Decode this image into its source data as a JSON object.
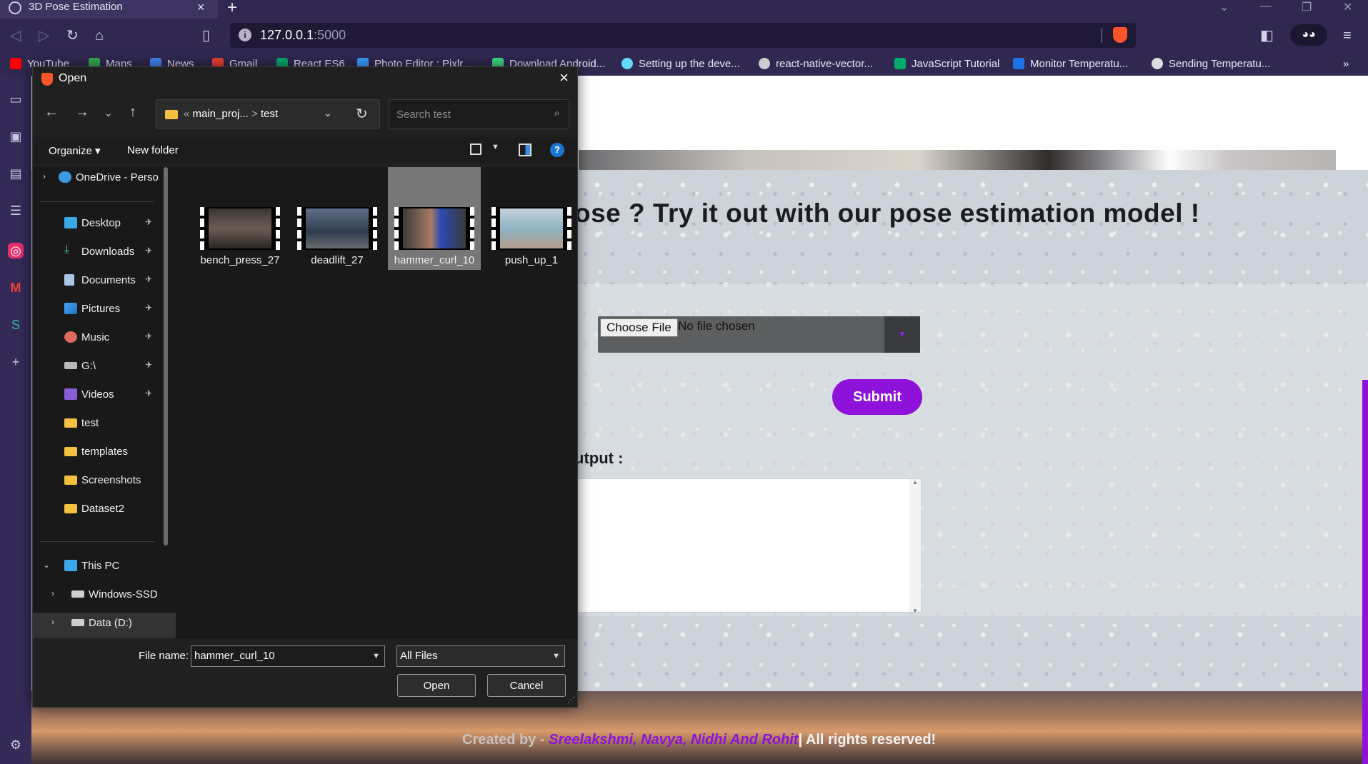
{
  "browser": {
    "tab_title": "3D Pose Estimation",
    "new_tab": "+",
    "url_host": "127.0.0.1",
    "url_port": ":5000",
    "bookmarks": [
      {
        "label": "YouTube",
        "color": "#ff0000"
      },
      {
        "label": "Maps",
        "color": "#34a853"
      },
      {
        "label": "News",
        "color": "#4285f4"
      },
      {
        "label": "Gmail",
        "color": "#ea4335"
      },
      {
        "label": "React ES6",
        "color": "#04aa6d"
      },
      {
        "label": "Photo Editor : Pixlr...",
        "color": "#3aa0ff"
      },
      {
        "label": "Download Android...",
        "color": "#3ddc84"
      },
      {
        "label": "Setting up the deve...",
        "color": "#61dafb"
      },
      {
        "label": "react-native-vector...",
        "color": "#cccccc"
      },
      {
        "label": "JavaScript Tutorial",
        "color": "#04aa6d"
      },
      {
        "label": "Monitor Temperatu...",
        "color": "#1a73e8"
      },
      {
        "label": "Sending Temperatu...",
        "color": "#dddddd"
      }
    ],
    "more_bookmarks": "»"
  },
  "page": {
    "heading": "ose ? Try it out with our pose estimation model !",
    "choose_file": "Choose File",
    "no_file": "No file chosen",
    "submit": "Submit",
    "output_label": "utput :",
    "footer_created": "Created by - ",
    "footer_names": "Sreelakshmi, Navya, Nidhi And Rohit",
    "footer_rights": "| All rights reserved!",
    "accent_color": "#8e12d9"
  },
  "dialog": {
    "title": "Open",
    "breadcrumb_prefix": "«",
    "breadcrumb_1": "main_proj...",
    "breadcrumb_sep": ">",
    "breadcrumb_2": "test",
    "search_placeholder": "Search test",
    "organize": "Organize ▾",
    "new_folder": "New folder",
    "nav_items": [
      {
        "label": "OneDrive - Perso",
        "icon": "cloud-icon"
      },
      {
        "label": "Desktop",
        "icon": "desktop-icon"
      },
      {
        "label": "Downloads",
        "icon": "download-icon"
      },
      {
        "label": "Documents",
        "icon": "document-icon"
      },
      {
        "label": "Pictures",
        "icon": "pictures-icon"
      },
      {
        "label": "Music",
        "icon": "music-icon"
      },
      {
        "label": "G:\\",
        "icon": "drive-icon"
      },
      {
        "label": "Videos",
        "icon": "videos-icon"
      },
      {
        "label": "test",
        "icon": "folder-icon"
      },
      {
        "label": "templates",
        "icon": "folder-icon"
      },
      {
        "label": "Screenshots",
        "icon": "folder-icon"
      },
      {
        "label": "Dataset2",
        "icon": "folder-icon"
      },
      {
        "label": "This PC",
        "icon": "computer-icon"
      },
      {
        "label": "Windows-SSD",
        "icon": "disk-icon"
      },
      {
        "label": "Data (D:)",
        "icon": "disk-icon"
      }
    ],
    "files": [
      {
        "name": "bench_press_27",
        "selected": false
      },
      {
        "name": "deadlift_27",
        "selected": false
      },
      {
        "name": "hammer_curl_10",
        "selected": true
      },
      {
        "name": "push_up_1",
        "selected": false
      }
    ],
    "file_name_label": "File name:",
    "file_name_value": "hammer_curl_10",
    "file_type_value": "All Files",
    "open_button": "Open",
    "cancel_button": "Cancel"
  }
}
